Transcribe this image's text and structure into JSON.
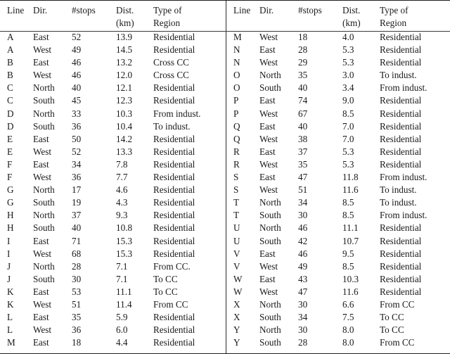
{
  "table": {
    "columns": [
      {
        "key": "line",
        "label_line1": "Line",
        "label_line2": ""
      },
      {
        "key": "dir",
        "label_line1": "Dir.",
        "label_line2": ""
      },
      {
        "key": "stops",
        "label_line1": "#stops",
        "label_line2": ""
      },
      {
        "key": "dist",
        "label_line1": "Dist.",
        "label_line2": "(km)"
      },
      {
        "key": "type",
        "label_line1": "Type of",
        "label_line2": "Region"
      }
    ],
    "left": {
      "headers": {
        "line_1": "Line",
        "line_2": "",
        "dir_1": "Dir.",
        "dir_2": "",
        "stops_1": "#stops",
        "stops_2": "",
        "dist_1": "Dist.",
        "dist_2": "(km)",
        "type_1": "Type of",
        "type_2": "Region"
      },
      "rows": [
        {
          "line": "A",
          "dir": "East",
          "stops": "52",
          "dist": "13.9",
          "type": "Residential"
        },
        {
          "line": "A",
          "dir": "West",
          "stops": "49",
          "dist": "14.5",
          "type": "Residential"
        },
        {
          "line": "B",
          "dir": "East",
          "stops": "46",
          "dist": "13.2",
          "type": "Cross CC"
        },
        {
          "line": "B",
          "dir": "West",
          "stops": "46",
          "dist": "12.0",
          "type": "Cross CC"
        },
        {
          "line": "C",
          "dir": "North",
          "stops": "40",
          "dist": "12.1",
          "type": "Residential"
        },
        {
          "line": "C",
          "dir": "South",
          "stops": "45",
          "dist": "12.3",
          "type": "Residential"
        },
        {
          "line": "D",
          "dir": "North",
          "stops": "33",
          "dist": "10.3",
          "type": "From indust."
        },
        {
          "line": "D",
          "dir": "South",
          "stops": "36",
          "dist": "10.4",
          "type": "To indust."
        },
        {
          "line": "E",
          "dir": "East",
          "stops": "50",
          "dist": "14.2",
          "type": "Residential"
        },
        {
          "line": "E",
          "dir": "West",
          "stops": "52",
          "dist": "13.3",
          "type": "Residential"
        },
        {
          "line": "F",
          "dir": "East",
          "stops": "34",
          "dist": "7.8",
          "type": "Residential"
        },
        {
          "line": "F",
          "dir": "West",
          "stops": "36",
          "dist": "7.7",
          "type": "Residential"
        },
        {
          "line": "G",
          "dir": "North",
          "stops": "17",
          "dist": "4.6",
          "type": "Residential"
        },
        {
          "line": "G",
          "dir": "South",
          "stops": "19",
          "dist": "4.3",
          "type": "Residential"
        },
        {
          "line": "H",
          "dir": "North",
          "stops": "37",
          "dist": "9.3",
          "type": "Residential"
        },
        {
          "line": "H",
          "dir": "South",
          "stops": "40",
          "dist": "10.8",
          "type": "Residential"
        },
        {
          "line": "I",
          "dir": "East",
          "stops": "71",
          "dist": "15.3",
          "type": "Residential"
        },
        {
          "line": "I",
          "dir": "West",
          "stops": "68",
          "dist": "15.3",
          "type": "Residential"
        },
        {
          "line": "J",
          "dir": "North",
          "stops": "28",
          "dist": "7.1",
          "type": "From CC."
        },
        {
          "line": "J",
          "dir": "South",
          "stops": "30",
          "dist": "7.1",
          "type": "To CC"
        },
        {
          "line": "K",
          "dir": "East",
          "stops": "53",
          "dist": "11.1",
          "type": "To CC"
        },
        {
          "line": "K",
          "dir": "West",
          "stops": "51",
          "dist": "11.4",
          "type": "From CC"
        },
        {
          "line": "L",
          "dir": "East",
          "stops": "35",
          "dist": "5.9",
          "type": "Residential"
        },
        {
          "line": "L",
          "dir": "West",
          "stops": "36",
          "dist": "6.0",
          "type": "Residential"
        },
        {
          "line": "M",
          "dir": "East",
          "stops": "18",
          "dist": "4.4",
          "type": "Residential"
        }
      ]
    },
    "right": {
      "headers": {
        "line_1": "Line",
        "line_2": "",
        "dir_1": "Dir.",
        "dir_2": "",
        "stops_1": "#stops",
        "stops_2": "",
        "dist_1": "Dist.",
        "dist_2": "(km)",
        "type_1": "Type of",
        "type_2": "Region"
      },
      "rows": [
        {
          "line": "M",
          "dir": "West",
          "stops": "18",
          "dist": "4.0",
          "type": "Residential"
        },
        {
          "line": "N",
          "dir": "East",
          "stops": "28",
          "dist": "5.3",
          "type": "Residential"
        },
        {
          "line": "N",
          "dir": "West",
          "stops": "29",
          "dist": "5.3",
          "type": "Residential"
        },
        {
          "line": "O",
          "dir": "North",
          "stops": "35",
          "dist": "3.0",
          "type": "To indust."
        },
        {
          "line": "O",
          "dir": "South",
          "stops": "40",
          "dist": "3.4",
          "type": "From indust."
        },
        {
          "line": "P",
          "dir": "East",
          "stops": "74",
          "dist": "9.0",
          "type": "Residential"
        },
        {
          "line": "P",
          "dir": "West",
          "stops": "67",
          "dist": "8.5",
          "type": "Residential"
        },
        {
          "line": "Q",
          "dir": "East",
          "stops": "40",
          "dist": "7.0",
          "type": "Residential"
        },
        {
          "line": "Q",
          "dir": "West",
          "stops": "38",
          "dist": "7.0",
          "type": "Residential"
        },
        {
          "line": "R",
          "dir": "East",
          "stops": "37",
          "dist": "5.3",
          "type": "Residential"
        },
        {
          "line": "R",
          "dir": "West",
          "stops": "35",
          "dist": "5.3",
          "type": "Residential"
        },
        {
          "line": "S",
          "dir": "East",
          "stops": "47",
          "dist": "11.8",
          "type": "From indust."
        },
        {
          "line": "S",
          "dir": "West",
          "stops": "51",
          "dist": "11.6",
          "type": "To indust."
        },
        {
          "line": "T",
          "dir": "North",
          "stops": "34",
          "dist": "8.5",
          "type": "To indust."
        },
        {
          "line": "T",
          "dir": "South",
          "stops": "30",
          "dist": "8.5",
          "type": "From indust."
        },
        {
          "line": "U",
          "dir": "North",
          "stops": "46",
          "dist": "11.1",
          "type": "Residential"
        },
        {
          "line": "U",
          "dir": "South",
          "stops": "42",
          "dist": "10.7",
          "type": "Residential"
        },
        {
          "line": "V",
          "dir": "East",
          "stops": "46",
          "dist": "9.5",
          "type": "Residential"
        },
        {
          "line": "V",
          "dir": "West",
          "stops": "49",
          "dist": "8.5",
          "type": "Residential"
        },
        {
          "line": "W",
          "dir": "East",
          "stops": "43",
          "dist": "10.3",
          "type": "Residential"
        },
        {
          "line": "W",
          "dir": "West",
          "stops": "47",
          "dist": "11.6",
          "type": "Residential"
        },
        {
          "line": "X",
          "dir": "North",
          "stops": "30",
          "dist": "6.6",
          "type": "From CC"
        },
        {
          "line": "X",
          "dir": "South",
          "stops": "34",
          "dist": "7.5",
          "type": "To CC"
        },
        {
          "line": "Y",
          "dir": "North",
          "stops": "30",
          "dist": "8.0",
          "type": "To CC"
        },
        {
          "line": "Y",
          "dir": "South",
          "stops": "28",
          "dist": "8.0",
          "type": "From CC"
        }
      ]
    }
  },
  "style": {
    "rule_color": "#1d1d1d",
    "text_color": "#1a1a1a",
    "divider_color": "#2b2b2b"
  }
}
